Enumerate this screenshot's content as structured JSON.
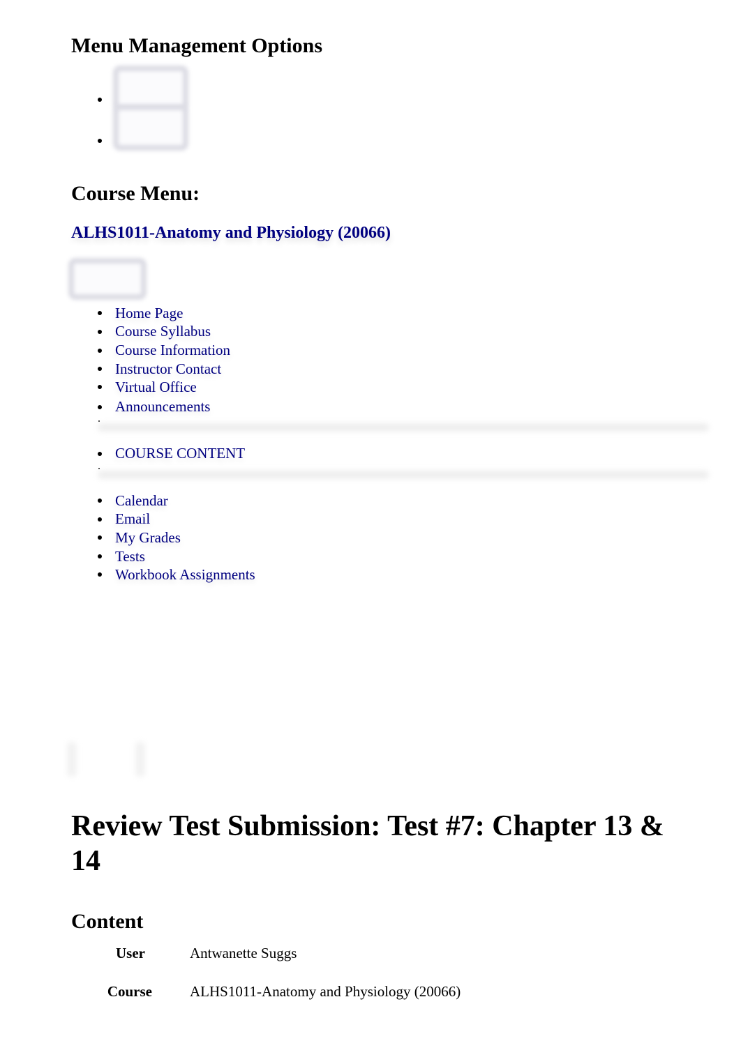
{
  "menu_management": {
    "title": "Menu Management Options"
  },
  "course_menu": {
    "title": "Course Menu:",
    "course_link": "ALHS1011-Anatomy and Physiology (20066)",
    "group1": [
      {
        "label": "Home Page"
      },
      {
        "label": "Course Syllabus"
      },
      {
        "label": "Course Information"
      },
      {
        "label": "Instructor Contact"
      },
      {
        "label": "Virtual Office"
      },
      {
        "label": "Announcements"
      }
    ],
    "group2": [
      {
        "label": "COURSE CONTENT"
      }
    ],
    "group3": [
      {
        "label": "Calendar"
      },
      {
        "label": "Email"
      },
      {
        "label": "My Grades"
      },
      {
        "label": "Tests"
      },
      {
        "label": "Workbook Assignments"
      }
    ],
    "link_color": "#000080"
  },
  "review": {
    "title": "Review Test Submission: Test #7: Chapter 13 & 14",
    "content_heading": "Content",
    "rows": [
      {
        "label": "User",
        "value": "Antwanette Suggs"
      },
      {
        "label": "Course",
        "value": "ALHS1011-Anatomy and Physiology (20066)"
      }
    ]
  }
}
